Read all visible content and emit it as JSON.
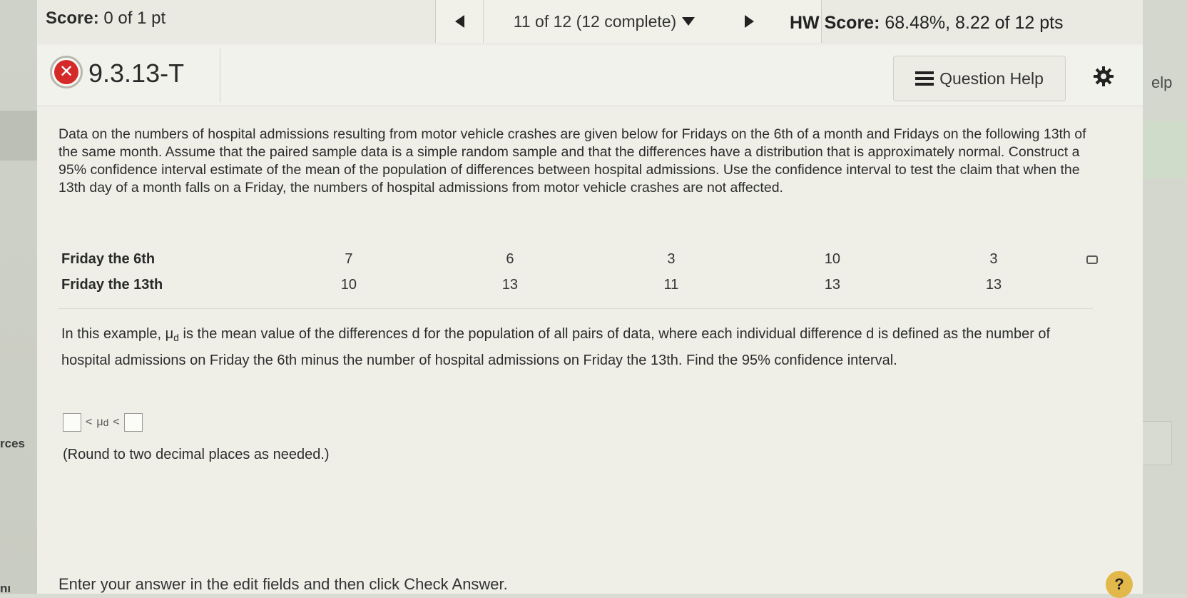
{
  "side": {
    "left_text": "rces",
    "left_text2": "nı",
    "right_text": "elp"
  },
  "score_bar": {
    "score_label": "Score:",
    "score_value": "0 of 1 pt",
    "nav_position": "11 of 12 (12 complete)",
    "hw_label": "HW Score:",
    "hw_value": "68.48%, 8.22 of 12 pts"
  },
  "question": {
    "id": "9.3.13-T",
    "status_icon": "incorrect-x-icon",
    "help_label": "Question Help"
  },
  "body": {
    "intro": "Data on the numbers of hospital admissions resulting from motor vehicle crashes are given below for Fridays on the 6th of a month and Fridays on the following 13th of the same month. Assume that the paired sample data is a simple random sample and that the differences have a distribution that is approximately normal. Construct a 95% confidence interval estimate of the mean of the population of differences between hospital admissions. Use the confidence interval to test the claim that when the 13th day of a month falls on a Friday, the numbers of hospital admissions from motor vehicle crashes are not affected.",
    "table": {
      "rows": [
        {
          "label": "Friday the 6th",
          "values": [
            "7",
            "6",
            "3",
            "10",
            "3"
          ]
        },
        {
          "label": "Friday the 13th",
          "values": [
            "10",
            "13",
            "11",
            "13",
            "13"
          ]
        }
      ]
    },
    "explain_part1": "In this example, ",
    "mu": "μ",
    "mu_sub": "d",
    "explain_part2": " is the mean value of the differences d for the population of all pairs of data, where each individual difference d is defined as the number of hospital admissions on Friday the 6th minus the number of hospital admissions on Friday the 13th. Find the 95% confidence interval.",
    "lt": "<",
    "round_note": "(Round to two decimal places as needed.)",
    "footer": "Enter your answer in the edit fields and then click Check Answer.",
    "help_symbol": "?"
  },
  "colors": {
    "incorrect": "#d52a2a",
    "help_badge": "#e2b84a"
  }
}
